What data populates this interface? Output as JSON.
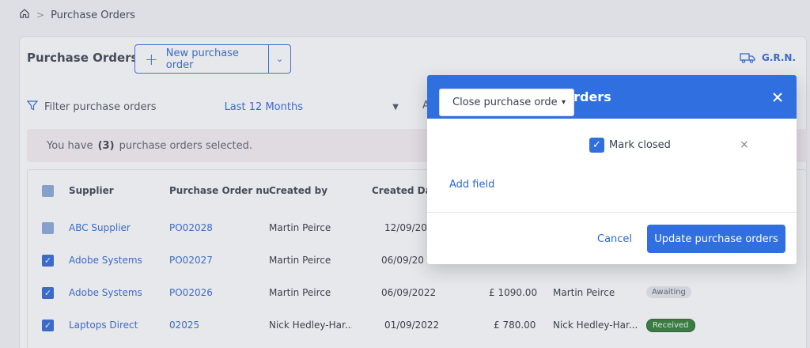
{
  "breadcrumb": {
    "home_icon": "home-icon",
    "separator": ">",
    "current": "Purchase Orders"
  },
  "header": {
    "title": "Purchase Orders",
    "new_button": "New purchase order",
    "new_button_caret": "⌄",
    "grn_label": "G.R.N."
  },
  "filters": {
    "search_placeholder": "Filter purchase orders",
    "period": "Last 12 Months",
    "period_caret": "▼",
    "extra_label": "A"
  },
  "selection_banner": {
    "prefix": "You have",
    "count": "(3)",
    "suffix": "purchase orders selected."
  },
  "table": {
    "headers": [
      "Supplier",
      "Purchase Order numb",
      "Created by",
      "Created Dat"
    ],
    "rows": [
      {
        "supplier": "ABC Supplier",
        "po": "PO02028",
        "created_by": "Martin Peirce",
        "created_date": "12/09/20",
        "amount": "",
        "approver": "",
        "status": ""
      },
      {
        "supplier": "Adobe Systems",
        "po": "PO02027",
        "created_by": "Martin Peirce",
        "created_date": "06/09/20",
        "amount": "",
        "approver": "",
        "status": ""
      },
      {
        "supplier": "Adobe Systems",
        "po": "PO02026",
        "created_by": "Martin Peirce",
        "created_date": "06/09/2022",
        "amount": "£ 1090.00",
        "approver": "Martin Peirce",
        "status": "Awaiting"
      },
      {
        "supplier": "Laptops Direct",
        "po": "02025",
        "created_by": "Nick Hedley-Har...",
        "created_date": "01/09/2022",
        "amount": "£ 780.00",
        "approver": "Nick Hedley-Har...",
        "status": "Received"
      }
    ]
  },
  "modal": {
    "title": "Update purchase orders",
    "close_icon": "close-icon",
    "field_select": "Close purchase orde",
    "field_select_caret": "▾",
    "checkbox_label": "Mark closed",
    "checkbox_checked": true,
    "remove_icon": "×",
    "add_field": "Add field",
    "cancel": "Cancel",
    "submit": "Update purchase orders"
  },
  "colors": {
    "accent": "#2f6fe0",
    "status_received": "#2f7a33"
  }
}
